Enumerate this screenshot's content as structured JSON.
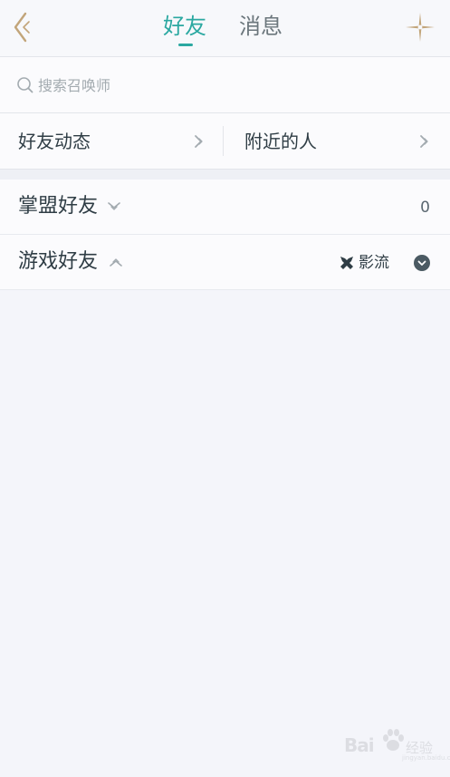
{
  "header": {
    "tabs": [
      {
        "label": "好友",
        "active": true
      },
      {
        "label": "消息",
        "active": false
      }
    ],
    "back_icon": "chevron-left-icon",
    "add_icon": "sparkle-cross-icon"
  },
  "search": {
    "placeholder": "搜索召唤师",
    "value": ""
  },
  "quick_links": [
    {
      "label": "好友动态"
    },
    {
      "label": "附近的人"
    }
  ],
  "groups": [
    {
      "title": "掌盟好友",
      "count": "0",
      "expanded": false
    },
    {
      "title": "游戏好友",
      "expanded": true,
      "region_label": "影流"
    }
  ],
  "watermark": {
    "brand": "Bai",
    "suffix": "经验",
    "url": "jingyan.baidu.com"
  },
  "colors": {
    "accent": "#2ba8a1",
    "gold": "#c2a57a",
    "background": "#f4f5fa",
    "text": "#2f3d45"
  }
}
